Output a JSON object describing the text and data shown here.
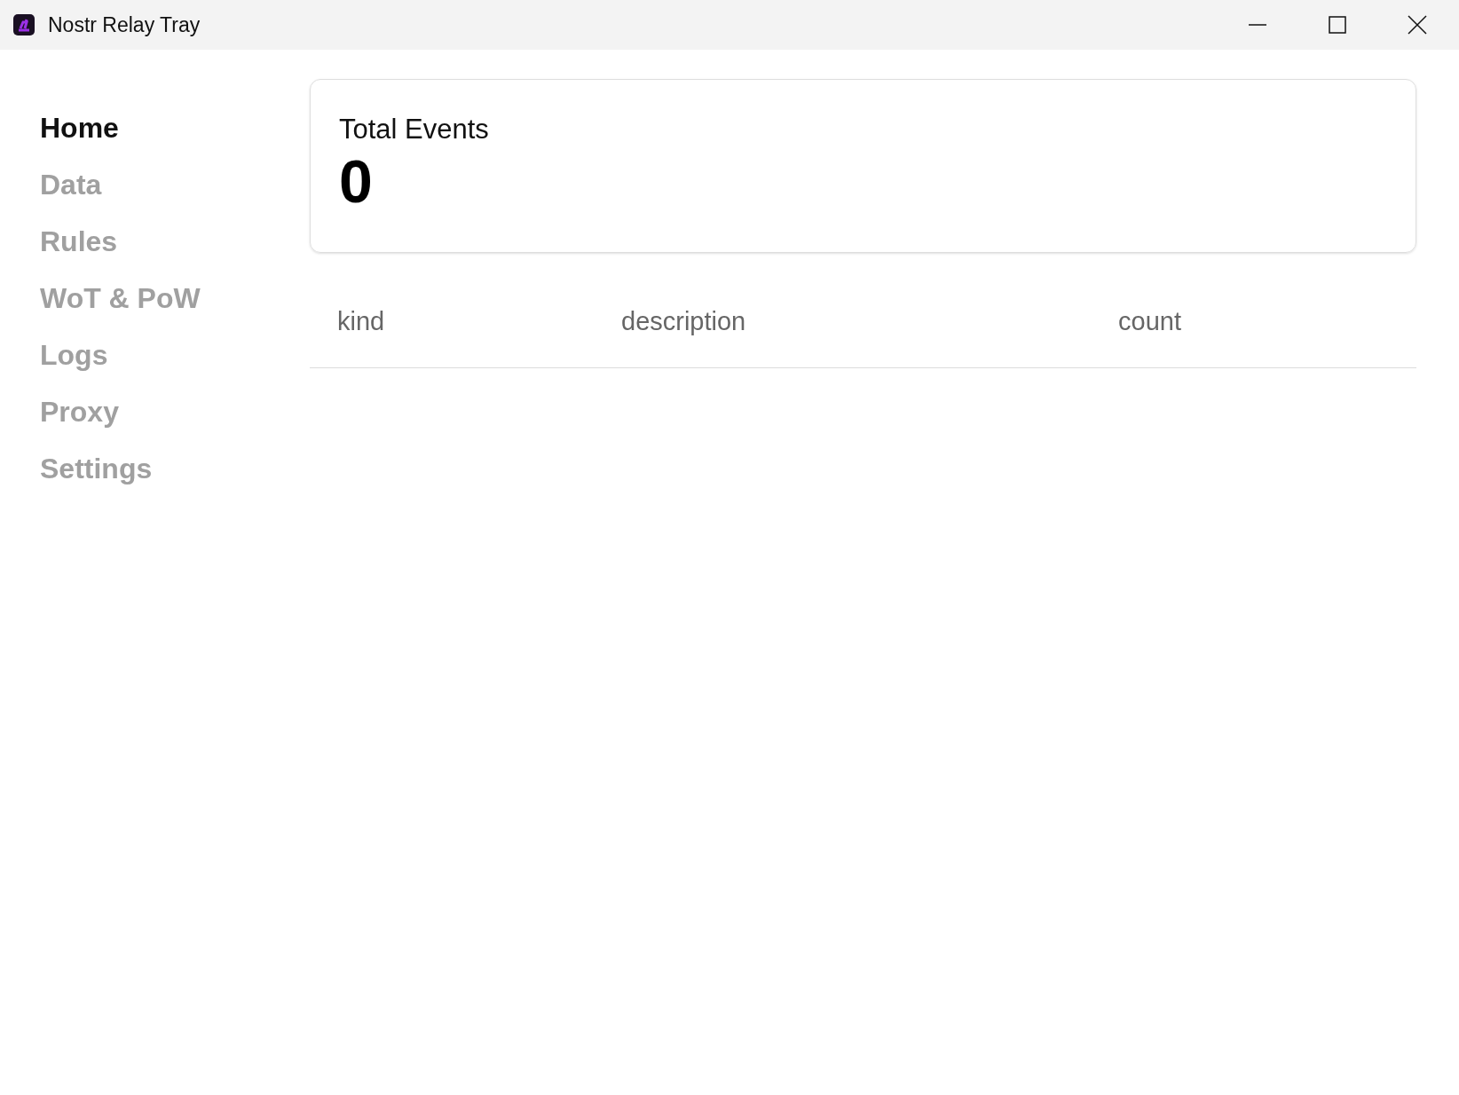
{
  "window": {
    "title": "Nostr Relay Tray"
  },
  "sidebar": {
    "items": [
      {
        "label": "Home",
        "selected": true
      },
      {
        "label": "Data",
        "selected": false
      },
      {
        "label": "Rules",
        "selected": false
      },
      {
        "label": "WoT & PoW",
        "selected": false
      },
      {
        "label": "Logs",
        "selected": false
      },
      {
        "label": "Proxy",
        "selected": false
      },
      {
        "label": "Settings",
        "selected": false
      }
    ]
  },
  "stat_card": {
    "label": "Total Events",
    "value": "0"
  },
  "table": {
    "columns": [
      "kind",
      "description",
      "count"
    ]
  }
}
